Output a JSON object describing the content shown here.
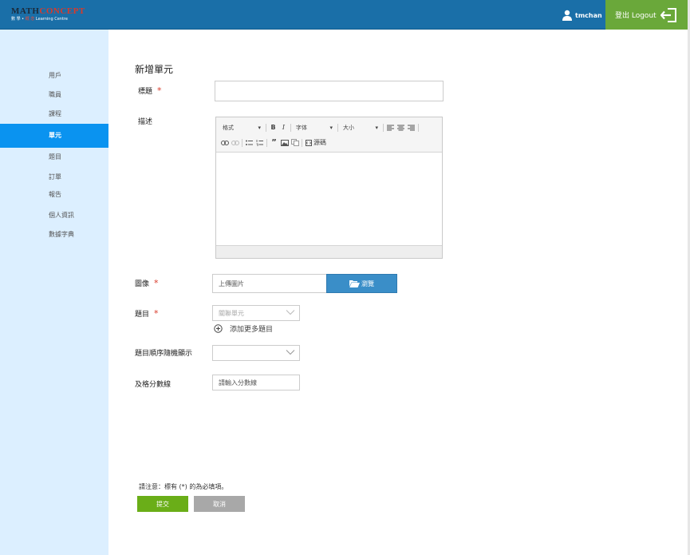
{
  "brand": {
    "logo_main_a": "MATH",
    "logo_main_b": "CONCEPT",
    "logo_sub_a": "數 學",
    "logo_sub_b": "概 念",
    "logo_sub_c": "Learning Centre"
  },
  "header": {
    "username": "tmchan",
    "logout_label": "登出 Logout"
  },
  "colors": {
    "topbar": "#1a6fa8",
    "logout": "#6aa83a",
    "sidebar": "#dcefff",
    "active": "#0a93f0",
    "required": "#d83a2a",
    "submit": "#6aae18"
  },
  "sidebar": {
    "items": [
      {
        "label": "用戶",
        "active": false
      },
      {
        "label": "職員",
        "active": false
      },
      {
        "label": "課程",
        "active": false
      },
      {
        "label": "單元",
        "active": true
      },
      {
        "label": "題目",
        "active": false
      },
      {
        "label": "訂單",
        "active": false
      },
      {
        "label": "報告",
        "active": false
      },
      {
        "label": "個人資訊",
        "active": false
      },
      {
        "label": "數據字典",
        "active": false
      }
    ]
  },
  "form": {
    "page_title": "新增單元",
    "title_label": "標題",
    "title_value": "",
    "description_label": "描述",
    "editor": {
      "format_label": "格式",
      "font_label": "字体",
      "size_label": "大小",
      "source_label": "源碼",
      "icons": [
        "bold-icon",
        "italic-icon",
        "align-left-icon",
        "align-center-icon",
        "align-right-icon",
        "link-icon",
        "unlink-icon",
        "bulleted-list-icon",
        "numbered-list-icon",
        "blockquote-icon",
        "image-icon",
        "table-icon",
        "source-icon"
      ]
    },
    "image_label": "圖像",
    "image_placeholder": "上傳圖片",
    "browse_label": "瀏覽",
    "questions_label": "題目",
    "questions_placeholder": "關聯單元",
    "add_more_label": "添加更多題目",
    "random_order_label": "題目順序隨機顯示",
    "random_order_value": "",
    "passing_label": "及格分數線",
    "passing_placeholder": "請輸入分數線",
    "required_mark": "*"
  },
  "footer": {
    "note": "請注意：標有 (*) 的為必填項。",
    "submit_label": "提交",
    "cancel_label": "取消"
  }
}
